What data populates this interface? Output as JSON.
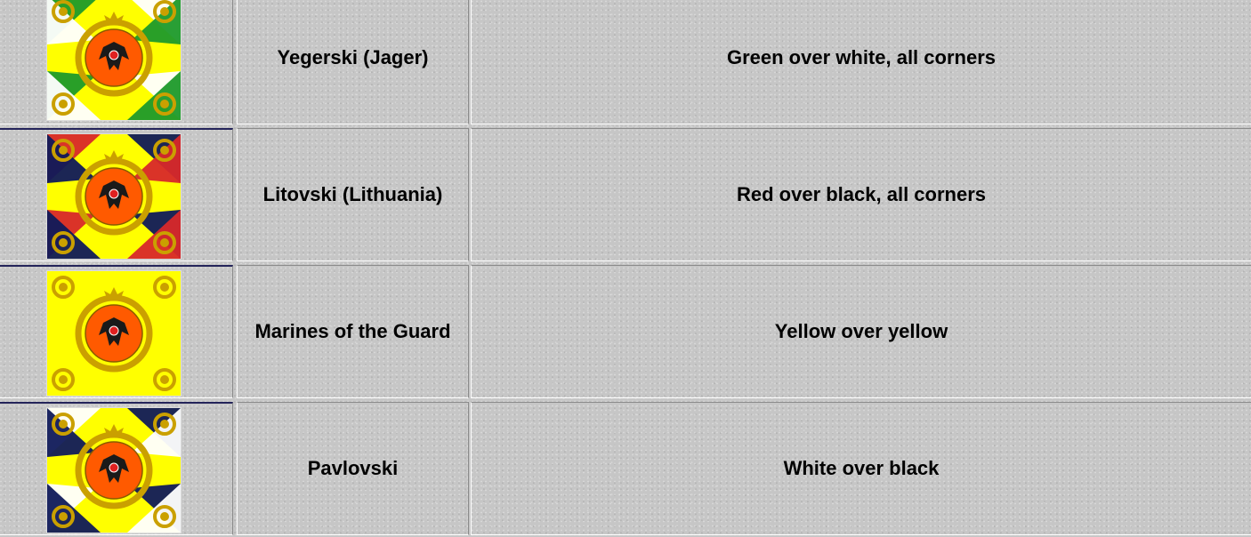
{
  "rows": [
    {
      "flag_icon": "regimental-flag-icon",
      "name": "Yegerski (Jager)",
      "description": "Green over white, all corners",
      "colors": {
        "field": "#ffff00",
        "corner_a": "#1e9a2a",
        "corner_b": "#ffffff",
        "medallion": "#ff5a00",
        "emblem": "#caa000"
      }
    },
    {
      "flag_icon": "regimental-flag-icon",
      "name": "Litovski (Lithuania)",
      "description": "Red over black, all corners",
      "colors": {
        "field": "#ffff00",
        "corner_a": "#d8282a",
        "corner_b": "#101a5a",
        "medallion": "#ff5a00",
        "emblem": "#caa000"
      }
    },
    {
      "flag_icon": "regimental-flag-icon",
      "name": "Marines of the Guard",
      "description": "Yellow over yellow",
      "colors": {
        "field": "#ffff00",
        "corner_a": "#ffff00",
        "corner_b": "#ffff00",
        "medallion": "#ff5a00",
        "emblem": "#caa000"
      }
    },
    {
      "flag_icon": "regimental-flag-icon",
      "name": "Pavlovski",
      "description": "White over black",
      "colors": {
        "field": "#ffff00",
        "corner_a": "#ffffff",
        "corner_b": "#101a5a",
        "medallion": "#ff5a00",
        "emblem": "#caa000"
      }
    }
  ]
}
